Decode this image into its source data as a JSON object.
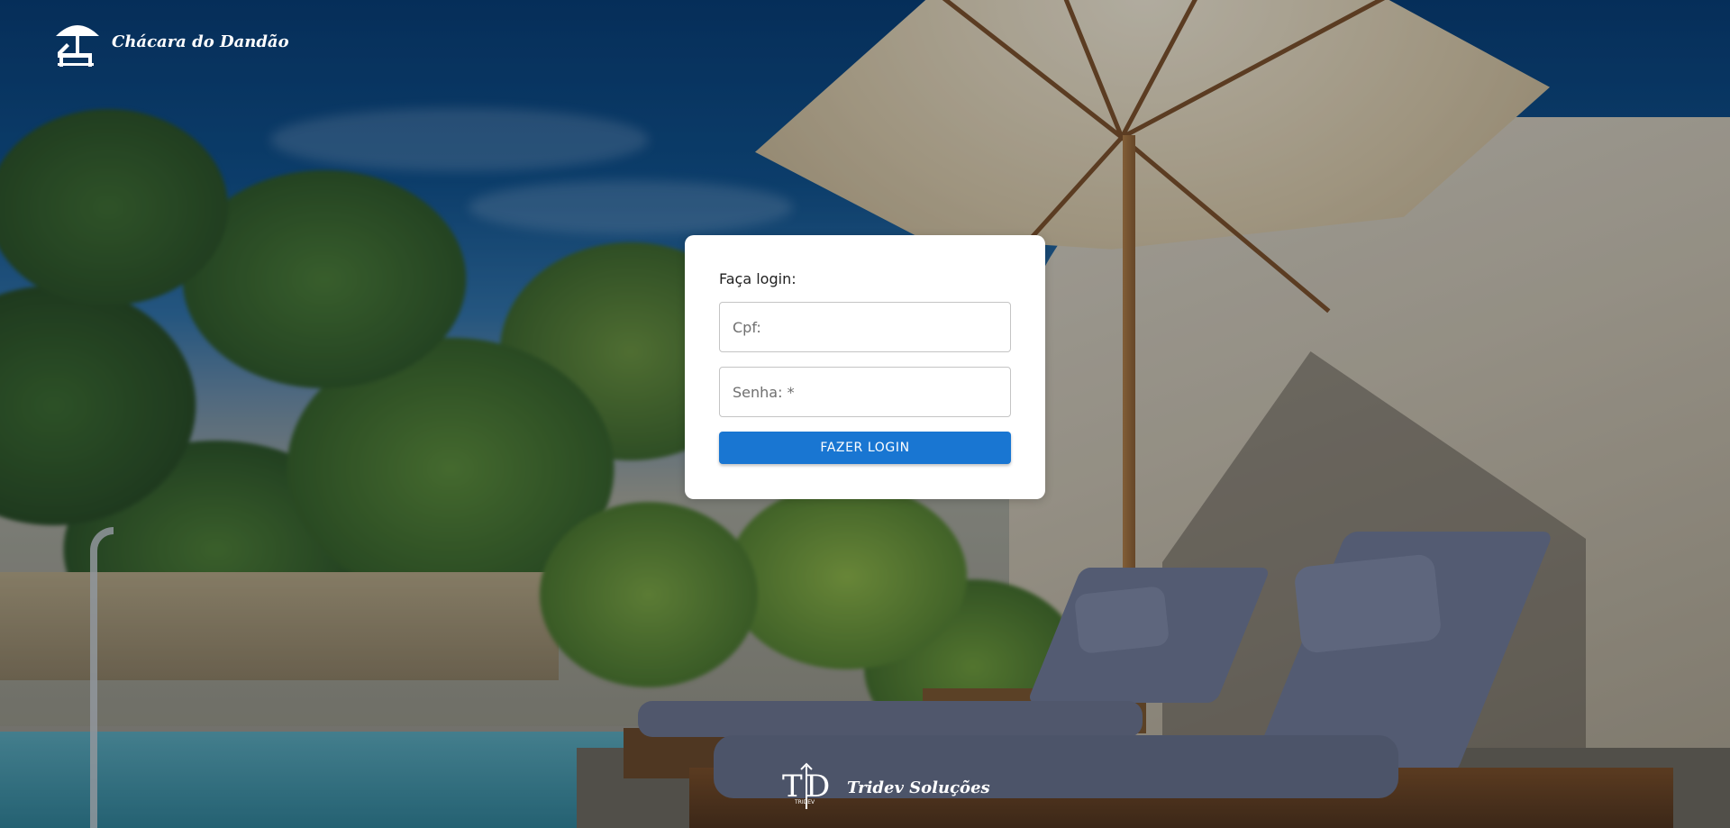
{
  "header": {
    "brand_name": "Chácara do Dandão",
    "brand_icon": "beach-umbrella-lounger-icon"
  },
  "login": {
    "title": "Faça login:",
    "cpf_placeholder": "Cpf:",
    "senha_placeholder": "Senha: *",
    "submit_label": "FAZER LOGIN"
  },
  "footer": {
    "logo_text": "TD",
    "logo_subtext": "TRIDEV",
    "company_name": "Tridev Soluções"
  },
  "colors": {
    "primary_button": "#1976d2",
    "card_background": "#ffffff",
    "brand_text": "#ffffff"
  }
}
